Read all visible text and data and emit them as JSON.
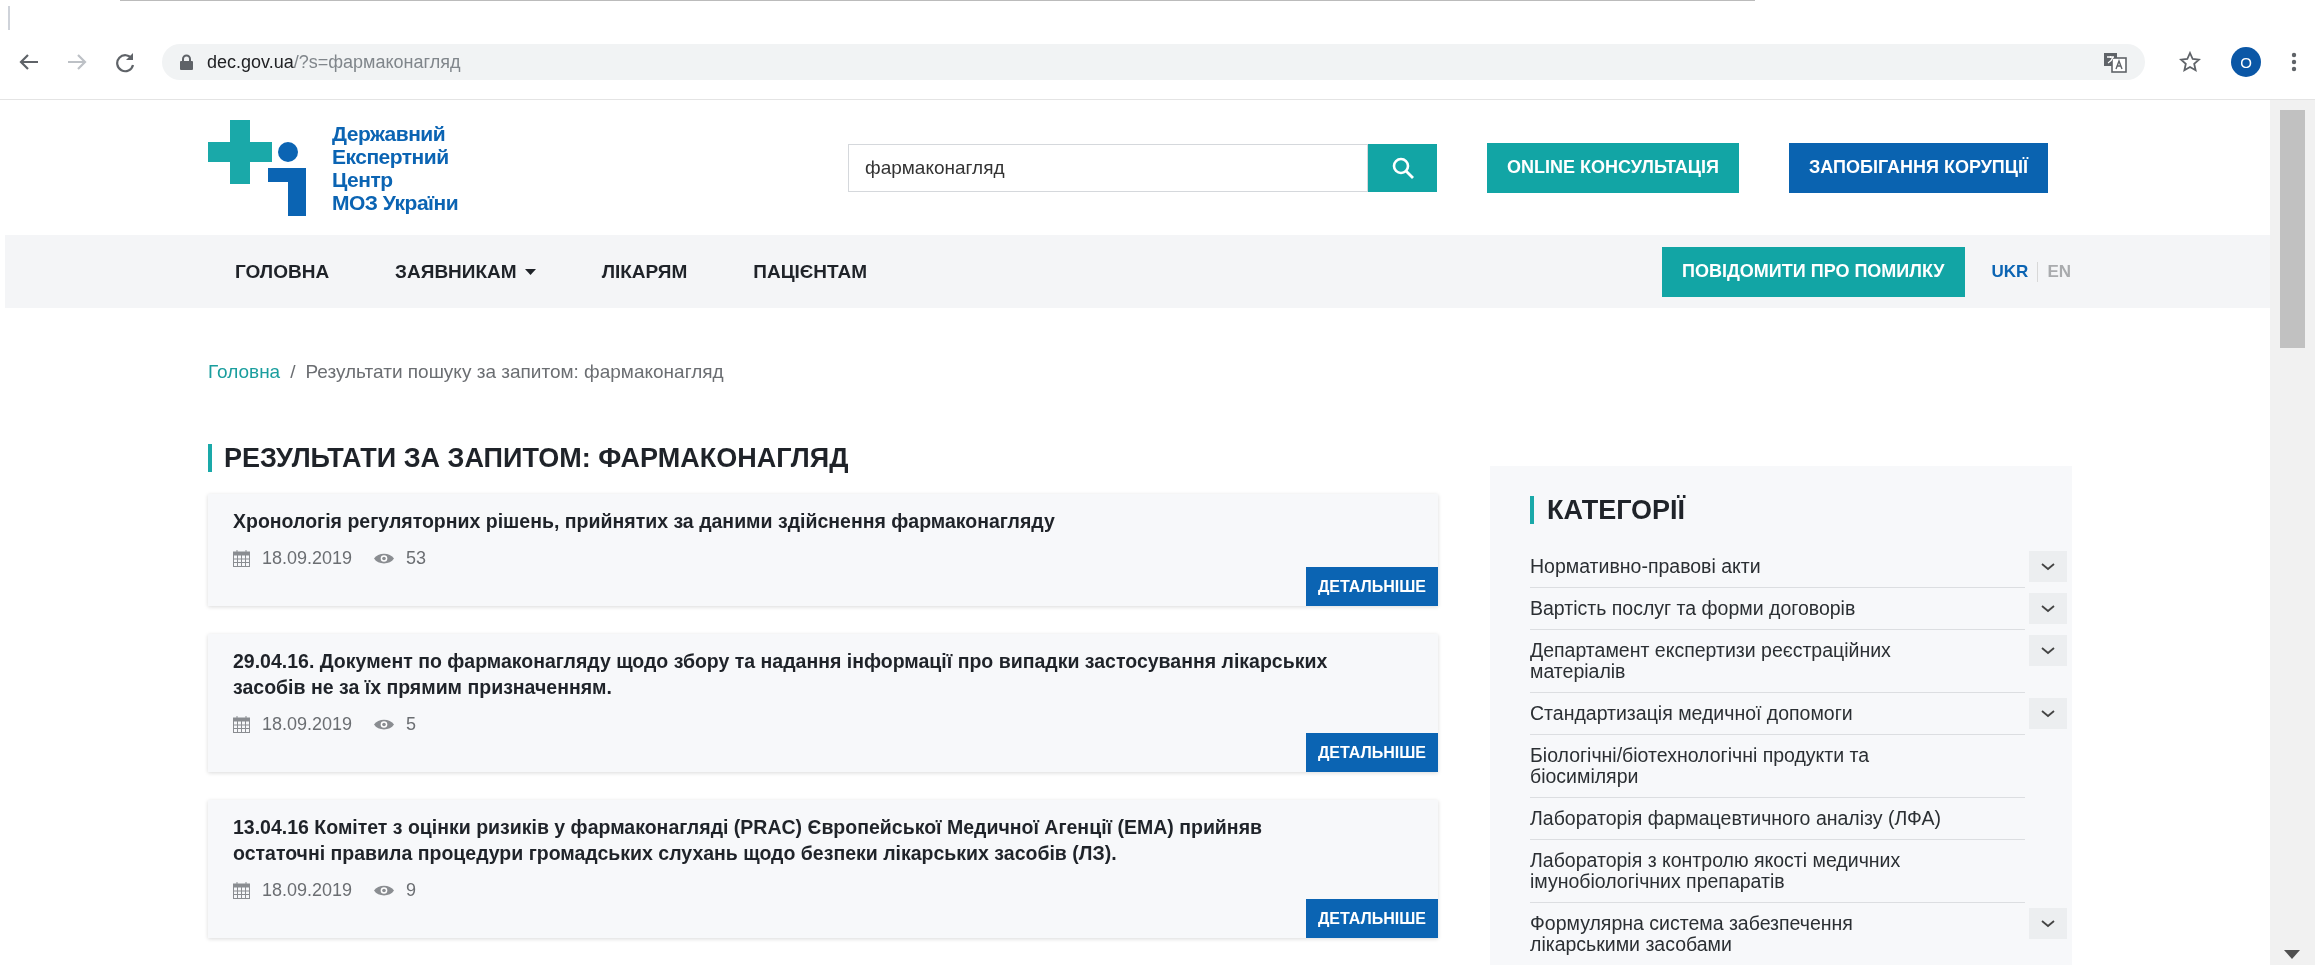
{
  "browser": {
    "url_host": "dec.gov.ua",
    "url_path": "/?s=фармаконагляд",
    "profile_initial": "O"
  },
  "header": {
    "logo_lines": [
      "Державний",
      "Експертний",
      "Центр",
      "МОЗ України"
    ],
    "search": {
      "value": "фармаконагляд"
    },
    "buttons": [
      {
        "label": "ONLINE КОНСУЛЬТАЦІЯ",
        "color": "#12a5a5"
      },
      {
        "label": "ЗАПОБІГАННЯ КОРУПЦІЇ",
        "color": "#0a63b0"
      }
    ]
  },
  "nav": {
    "items": [
      {
        "label": "ГОЛОВНА",
        "has_dropdown": false
      },
      {
        "label": "ЗАЯВНИКАМ",
        "has_dropdown": true
      },
      {
        "label": "ЛІКАРЯМ",
        "has_dropdown": false
      },
      {
        "label": "ПАЦІЄНТАМ",
        "has_dropdown": false
      }
    ],
    "report_button": "ПОВІДОМИТИ ПРО ПОМИЛКУ",
    "languages": [
      {
        "label": "UKR",
        "selected": true
      },
      {
        "label": "EN",
        "selected": false
      }
    ]
  },
  "breadcrumb": {
    "separator": "/",
    "items": [
      {
        "label": "Головна",
        "kind": "link"
      },
      {
        "label": "Результати пошуку за запитом: фармаконагляд",
        "kind": "current"
      }
    ]
  },
  "results": {
    "title": "РЕЗУЛЬТАТИ ЗА ЗАПИТОМ: ФАРМАКОНАГЛЯД",
    "items": [
      {
        "title": "Хронологія регуляторних рішень, прийнятих за даними здійснення фармаконагляду",
        "date": "18.09.2019",
        "views": "53",
        "button": "ДЕТАЛЬНІШЕ"
      },
      {
        "title": "29.04.16. Документ по фармаконагляду щодо збору та надання інформації про випадки застосування лікарських засобів не за їх прямим призначенням.",
        "date": "18.09.2019",
        "views": "5",
        "button": "ДЕТАЛЬНІШЕ"
      },
      {
        "title": "13.04.16 Комітет з оцінки ризиків у фармаконагляді (PRAC) Європейської Медичної Агенції (ЕМА) прийняв остаточні правила процедури громадських слухань щодо безпеки лікарських засобів (ЛЗ).",
        "date": "18.09.2019",
        "views": "9",
        "button": "ДЕТАЛЬНІШЕ"
      }
    ]
  },
  "categories": {
    "title": "КАТЕГОРІЇ",
    "items": [
      {
        "label": "Нормативно-правові акти",
        "expandable": true
      },
      {
        "label": "Вартість послуг та форми договорів",
        "expandable": true
      },
      {
        "label": "Департамент експертизи реєстраційних матеріалів",
        "expandable": true
      },
      {
        "label": "Стандартизація медичної допомоги",
        "expandable": true
      },
      {
        "label": "Біологічні/біотехнологічні продукти та біосиміляри",
        "expandable": false
      },
      {
        "label": "Лабораторія фармацевтичного аналізу (ЛФА)",
        "expandable": false
      },
      {
        "label": "Лабораторія з контролю якості медичних імунобіологічних препаратів",
        "expandable": false
      },
      {
        "label": "Формулярна система забезпечення лікарськими засобами",
        "expandable": true
      }
    ]
  }
}
